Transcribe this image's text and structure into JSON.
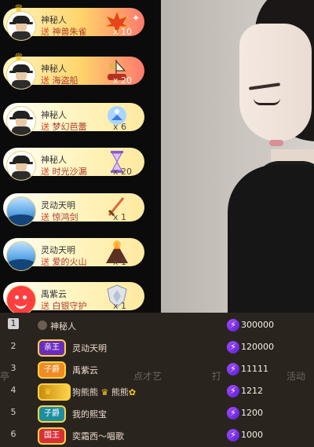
{
  "gifts": [
    {
      "user": "神秘人",
      "send": "送",
      "gift": "神兽朱雀",
      "qty": "x 10",
      "avatar": "mystery",
      "style": "hot",
      "icon": "phoenix-icon",
      "crown": true
    },
    {
      "user": "神秘人",
      "send": "送",
      "gift": "海盗船",
      "qty": "x 20",
      "avatar": "mystery",
      "style": "hot",
      "icon": "pirate-ship-icon",
      "crown": true
    },
    {
      "user": "神秘人",
      "send": "送",
      "gift": "梦幻芭蕾",
      "qty": "x 6",
      "avatar": "mystery",
      "style": "normal",
      "icon": "ballet-icon",
      "crown": false
    },
    {
      "user": "神秘人",
      "send": "送",
      "gift": "时光沙漏",
      "qty": "x 20",
      "avatar": "mystery",
      "style": "normal",
      "icon": "hourglass-icon",
      "crown": false
    },
    {
      "user": "灵动天明",
      "send": "送",
      "gift": "惊鸿剑",
      "qty": "x 1",
      "avatar": "sea",
      "style": "normal",
      "icon": "sword-icon",
      "crown": false
    },
    {
      "user": "灵动天明",
      "send": "送",
      "gift": "爱的火山",
      "qty": "x 1",
      "avatar": "sea",
      "style": "normal",
      "icon": "volcano-icon",
      "crown": false
    },
    {
      "user": "禹紫云",
      "send": "送",
      "gift": "白银守护",
      "qty": "x 1",
      "avatar": "red",
      "style": "normal",
      "icon": "silver-shield-icon",
      "crown": false
    }
  ],
  "ranking": [
    {
      "rank": "1",
      "name": "神秘人",
      "badge": "",
      "score": "300000"
    },
    {
      "rank": "2",
      "name": "灵动天明",
      "badge": "亲王",
      "score": "120000"
    },
    {
      "rank": "3",
      "name": "禹紫云",
      "badge": "子爵",
      "score": "11111"
    },
    {
      "rank": "4",
      "name": "狗熊熊",
      "name_suffix": "熊熊",
      "badge": "",
      "score": "1212"
    },
    {
      "rank": "5",
      "name": "我的熙宝",
      "badge": "子爵",
      "score": "1200"
    },
    {
      "rank": "6",
      "name": "奕霜西～唱歌",
      "badge": "国王",
      "score": "1000"
    }
  ],
  "faded": [
    "亭",
    "点才艺",
    "打",
    "活动"
  ],
  "colors": {
    "accent": "#ffd33f",
    "bolt": "#8a35f2",
    "feed_text": "#ab3b2d"
  }
}
